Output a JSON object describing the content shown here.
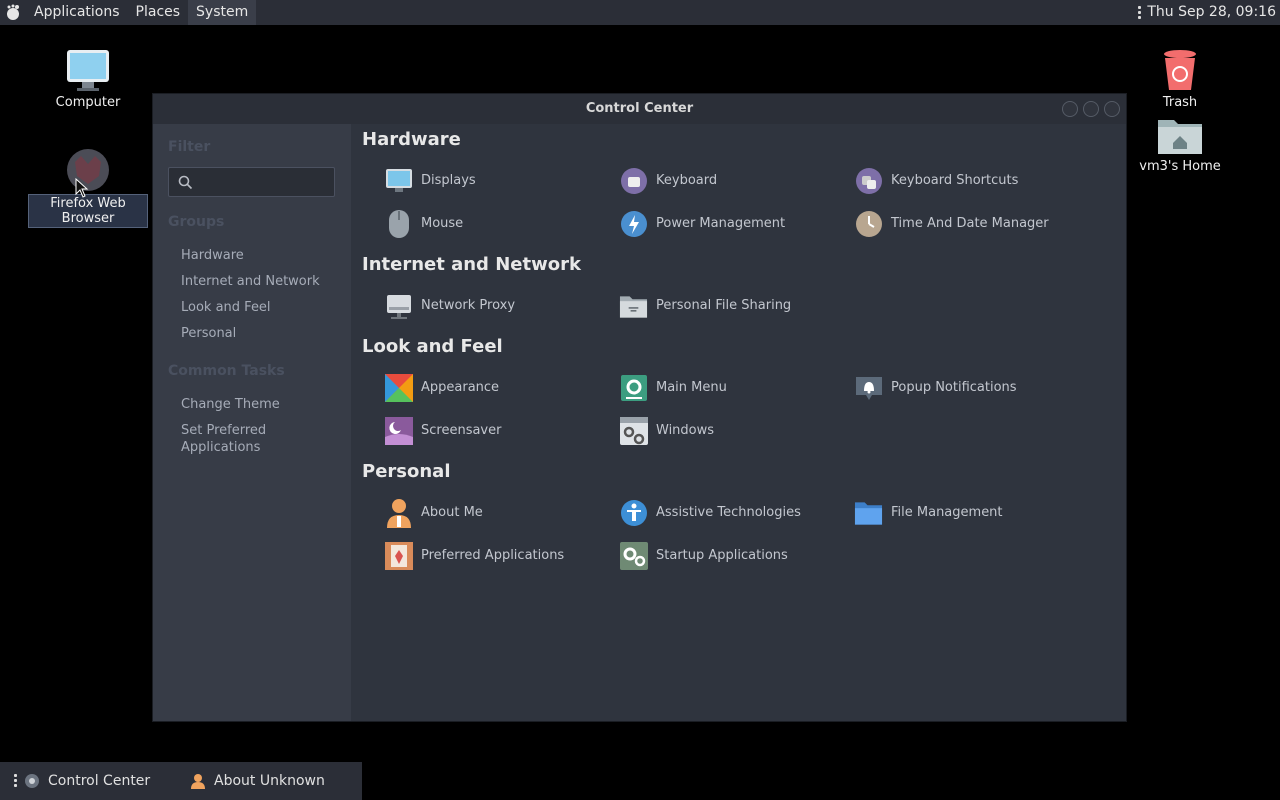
{
  "top_panel": {
    "menus": [
      "Applications",
      "Places",
      "System"
    ],
    "clock": "Thu Sep 28, 09:16"
  },
  "desktop": {
    "computer": "Computer",
    "firefox": "Firefox Web Browser",
    "trash": "Trash",
    "home": "vm3's Home"
  },
  "window": {
    "title": "Control Center",
    "sidebar": {
      "filter_heading": "Filter",
      "search_placeholder": "",
      "groups_heading": "Groups",
      "groups": [
        "Hardware",
        "Internet and Network",
        "Look and Feel",
        "Personal"
      ],
      "tasks_heading": "Common Tasks",
      "tasks": [
        "Change Theme",
        "Set Preferred\nApplications"
      ]
    },
    "sections": {
      "hardware": {
        "title": "Hardware",
        "items": [
          "Displays",
          "Keyboard",
          "Keyboard Shortcuts",
          "Mouse",
          "Power Management",
          "Time And Date Manager"
        ]
      },
      "network": {
        "title": "Internet and Network",
        "items": [
          "Network Proxy",
          "Personal File Sharing"
        ]
      },
      "look": {
        "title": "Look and Feel",
        "items": [
          "Appearance",
          "Main Menu",
          "Popup Notifications",
          "Screensaver",
          "Windows"
        ]
      },
      "personal": {
        "title": "Personal",
        "items": [
          "About Me",
          "Assistive Technologies",
          "File Management",
          "Preferred Applications",
          "Startup Applications"
        ]
      }
    }
  },
  "taskbar": {
    "tasks": [
      "Control Center",
      "About Unknown"
    ]
  },
  "colors": {
    "panel": "#2b2e37",
    "window_bg": "#2f343e",
    "sidebar_bg": "#373c47"
  }
}
